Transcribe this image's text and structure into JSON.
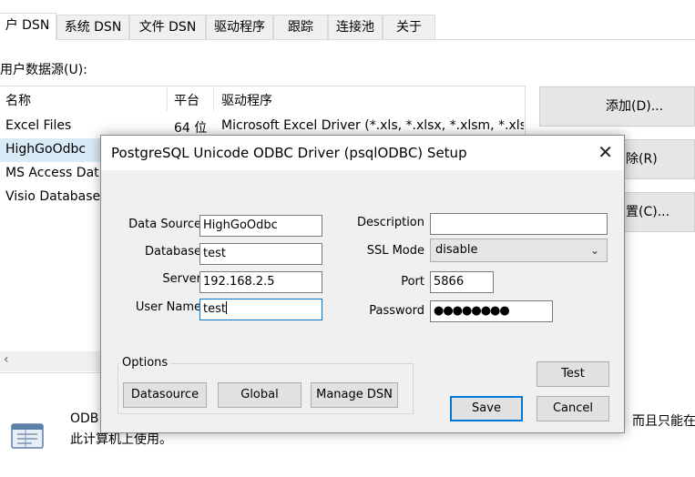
{
  "tabs": [
    "户 DSN",
    "系统 DSN",
    "文件 DSN",
    "驱动程序",
    "跟踪",
    "连接池",
    "关于"
  ],
  "user_data_sources_label": "用户数据源(U):",
  "list": {
    "headers": {
      "name": "名称",
      "platform": "平台",
      "driver": "驱动程序"
    },
    "rows": [
      {
        "name": "Excel Files",
        "platform": "64 位",
        "driver": "Microsoft Excel Driver (*.xls, *.xlsx, *.xlsm, *.xls"
      },
      {
        "name": "HighGoOdbc"
      },
      {
        "name": "MS Access Dat"
      },
      {
        "name": "Visio Database"
      }
    ]
  },
  "side_buttons": {
    "add": "添加(D)...",
    "remove": "除(R)",
    "configure": "置(C)..."
  },
  "bottom": {
    "text_line1_left": "ODB",
    "text_line1_right": "，而且只能在",
    "text_line2": "此计算机上使用。"
  },
  "dialog": {
    "title": "PostgreSQL Unicode ODBC Driver (psqlODBC) Setup",
    "labels": {
      "data_source": "Data Source",
      "database": "Database",
      "server": "Server",
      "user_name": "User Name",
      "description": "Description",
      "ssl_mode": "SSL Mode",
      "port": "Port",
      "password": "Password"
    },
    "values": {
      "data_source": "HighGoOdbc",
      "database": "test",
      "server": "192.168.2.5",
      "user_name": "test",
      "description": "",
      "ssl_mode": "disable",
      "port": "5866",
      "password": "●●●●●●●●"
    },
    "options_label": "Options",
    "buttons": {
      "datasource": "Datasource",
      "global": "Global",
      "manage_dsn": "Manage DSN",
      "test": "Test",
      "save": "Save",
      "cancel": "Cancel"
    }
  }
}
